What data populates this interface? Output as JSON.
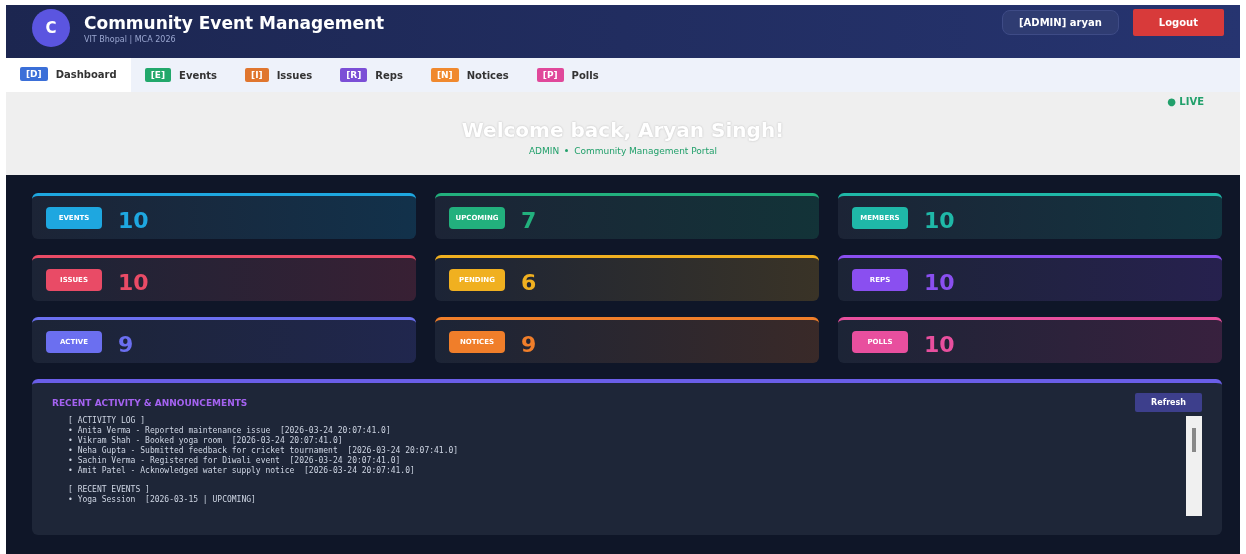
{
  "header": {
    "logo_letter": "C",
    "title": "Community Event Management",
    "subtitle": "VIT Bhopal | MCA 2026",
    "user": "[ADMIN] aryan",
    "logout": "Logout"
  },
  "tabs": [
    {
      "badge": "[D]",
      "label": "Dashboard",
      "color": "#3b6fd8",
      "selected": true
    },
    {
      "badge": "[E]",
      "label": "Events",
      "color": "#22a86b",
      "selected": false
    },
    {
      "badge": "[I]",
      "label": "Issues",
      "color": "#e0762e",
      "selected": false
    },
    {
      "badge": "[R]",
      "label": "Reps",
      "color": "#7b4fd6",
      "selected": false
    },
    {
      "badge": "[N]",
      "label": "Notices",
      "color": "#f0892e",
      "selected": false
    },
    {
      "badge": "[P]",
      "label": "Polls",
      "color": "#e0489a",
      "selected": false
    }
  ],
  "welcome": {
    "title": "Welcome back, Aryan Singh!",
    "role": "ADMIN",
    "portal": "Community Management Portal",
    "live": "● LIVE"
  },
  "stats": [
    {
      "label": "EVENTS",
      "value": "10",
      "color": "#1ea7e0"
    },
    {
      "label": "UPCOMING",
      "value": "7",
      "color": "#22b07d"
    },
    {
      "label": "MEMBERS",
      "value": "10",
      "color": "#1fb8a8"
    },
    {
      "label": "ISSUES",
      "value": "10",
      "color": "#e94b66"
    },
    {
      "label": "PENDING",
      "value": "6",
      "color": "#f0b020"
    },
    {
      "label": "REPS",
      "value": "10",
      "color": "#8a4ff0"
    },
    {
      "label": "ACTIVE",
      "value": "9",
      "color": "#6b6ff0"
    },
    {
      "label": "NOTICES",
      "value": "9",
      "color": "#f07e2a"
    },
    {
      "label": "POLLS",
      "value": "10",
      "color": "#e84f9e"
    }
  ],
  "activity": {
    "title": "RECENT ACTIVITY & ANNOUNCEMENTS",
    "refresh": "Refresh",
    "sections": [
      {
        "heading": "[ ACTIVITY LOG ]",
        "lines": [
          "• Anita Verma - Reported maintenance issue  [2026-03-24 20:07:41.0]",
          "• Vikram Shah - Booked yoga room  [2026-03-24 20:07:41.0]",
          "• Neha Gupta - Submitted feedback for cricket tournament  [2026-03-24 20:07:41.0]",
          "• Sachin Verma - Registered for Diwali event  [2026-03-24 20:07:41.0]",
          "• Amit Patel - Acknowledged water supply notice  [2026-03-24 20:07:41.0]"
        ]
      },
      {
        "heading": "[ RECENT EVENTS ]",
        "lines": [
          "• Yoga Session  [2026-03-15 | UPCOMING]"
        ]
      }
    ]
  }
}
